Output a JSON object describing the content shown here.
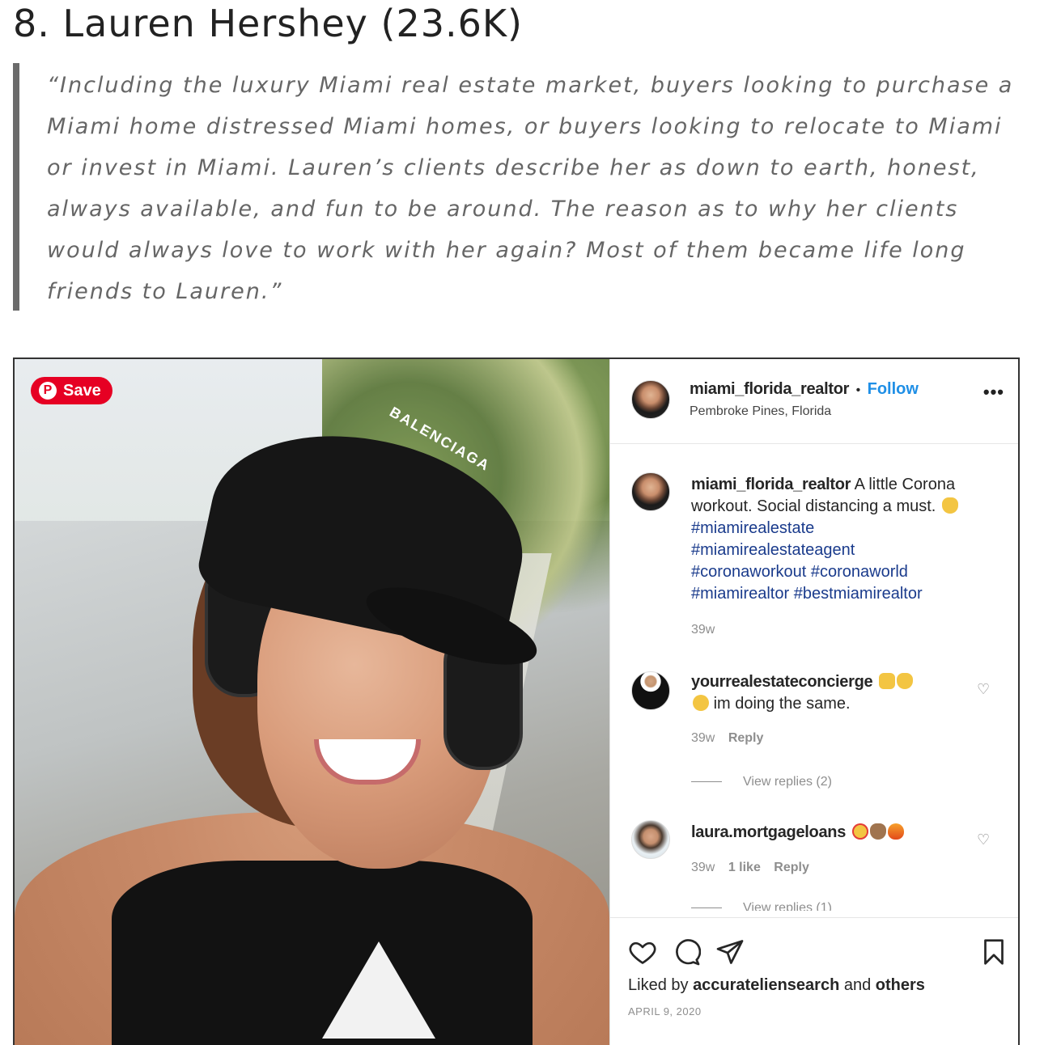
{
  "article": {
    "heading": "8. Lauren Hershey (23.6K)",
    "quote": "“Including the luxury Miami real estate market, buyers looking to purchase a Miami home distressed Miami homes, or buyers looking to relocate to Miami or invest in Miami. Lauren’s clients describe her as down to earth, honest, always available, and fun to be around. The reason as to why her clients would always love to work with her again? Most of them became life long friends to Lauren.”"
  },
  "pin": {
    "save_label": "Save",
    "icon": "pinterest-icon"
  },
  "photo": {
    "cap_text": "BALENCIAGA"
  },
  "post": {
    "username": "miami_florida_realtor",
    "separator": "•",
    "follow_label": "Follow",
    "location": "Pembroke Pines, Florida",
    "more_icon": "•••",
    "caption_user": "miami_florida_realtor",
    "caption_text": "A little Corona workout. Social distancing a must.",
    "hashtags": [
      "#miamirealestate",
      "#miamirealestateagent",
      "#coronaworkout #coronaworld",
      "#miamirealtor #bestmiamirealtor"
    ],
    "caption_time": "39w",
    "comments": [
      {
        "user": "yourrealestateconcierge",
        "text": "im doing the same.",
        "time": "39w",
        "likes": "",
        "reply_label": "Reply",
        "view_replies": "View replies (2)"
      },
      {
        "user": "laura.mortgageloans",
        "text": "",
        "time": "39w",
        "likes": "1 like",
        "reply_label": "Reply",
        "view_replies": "View replies (1)"
      }
    ],
    "liked_prefix": "Liked by",
    "liked_user": "accurateliensearch",
    "liked_and": "and",
    "liked_others": "others",
    "date": "APRIL 9, 2020"
  },
  "colors": {
    "pinterest": "#e60023",
    "follow": "#1f8fe6",
    "quote_bar": "#6b6b6b"
  }
}
